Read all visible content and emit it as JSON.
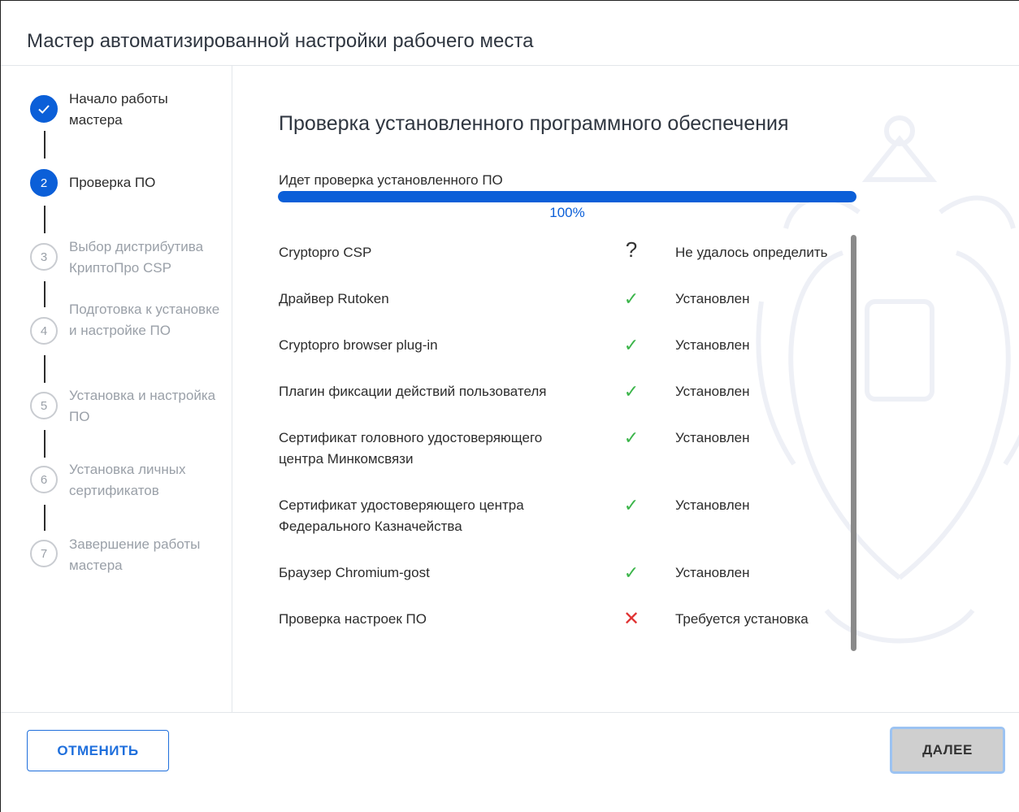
{
  "window": {
    "title": "Мастер автоматизированной настройки рабочего места"
  },
  "sidebar": {
    "steps": [
      {
        "number": "1",
        "label": "Начало работы мастера",
        "state": "done"
      },
      {
        "number": "2",
        "label": "Проверка ПО",
        "state": "active"
      },
      {
        "number": "3",
        "label": "Выбор дистрибутива КриптоПро CSP",
        "state": "pending"
      },
      {
        "number": "4",
        "label": "Подготовка к установке и настройке ПО",
        "state": "pending"
      },
      {
        "number": "5",
        "label": "Установка и настройка ПО",
        "state": "pending"
      },
      {
        "number": "6",
        "label": "Установка личных сертификатов",
        "state": "pending"
      },
      {
        "number": "7",
        "label": "Завершение работы мастера",
        "state": "pending"
      }
    ]
  },
  "main": {
    "title": "Проверка установленного программного обеспечения",
    "progress": {
      "label": "Идет проверка установленного ПО",
      "value": 100,
      "percent_text": "100%"
    },
    "items": [
      {
        "name": "Cryptopro CSP",
        "status": "Не удалось определить",
        "icon": "question-icon",
        "state": "unknown"
      },
      {
        "name": "Драйвер Rutoken",
        "status": "Установлен",
        "icon": "check-icon",
        "state": "ok"
      },
      {
        "name": "Cryptopro browser plug-in",
        "status": "Установлен",
        "icon": "check-icon",
        "state": "ok"
      },
      {
        "name": "Плагин фиксации действий пользователя",
        "status": "Установлен",
        "icon": "check-icon",
        "state": "ok"
      },
      {
        "name": "Сертификат головного удостоверяющего центра Минкомсвязи",
        "status": "Установлен",
        "icon": "check-icon",
        "state": "ok"
      },
      {
        "name": "Сертификат удостоверяющего центра Федерального Казначейства",
        "status": "Установлен",
        "icon": "check-icon",
        "state": "ok"
      },
      {
        "name": "Браузер Chromium-gost",
        "status": "Установлен",
        "icon": "check-icon",
        "state": "ok"
      },
      {
        "name": "Проверка настроек ПО",
        "status": "Требуется установка",
        "icon": "cross-icon",
        "state": "fail"
      }
    ]
  },
  "footer": {
    "cancel_label": "ОТМЕНИТЬ",
    "next_label": "ДАЛЕЕ"
  },
  "colors": {
    "accent": "#0b5fd8",
    "success": "#3bb54a",
    "error": "#e03232",
    "muted": "#9aa0a8"
  }
}
